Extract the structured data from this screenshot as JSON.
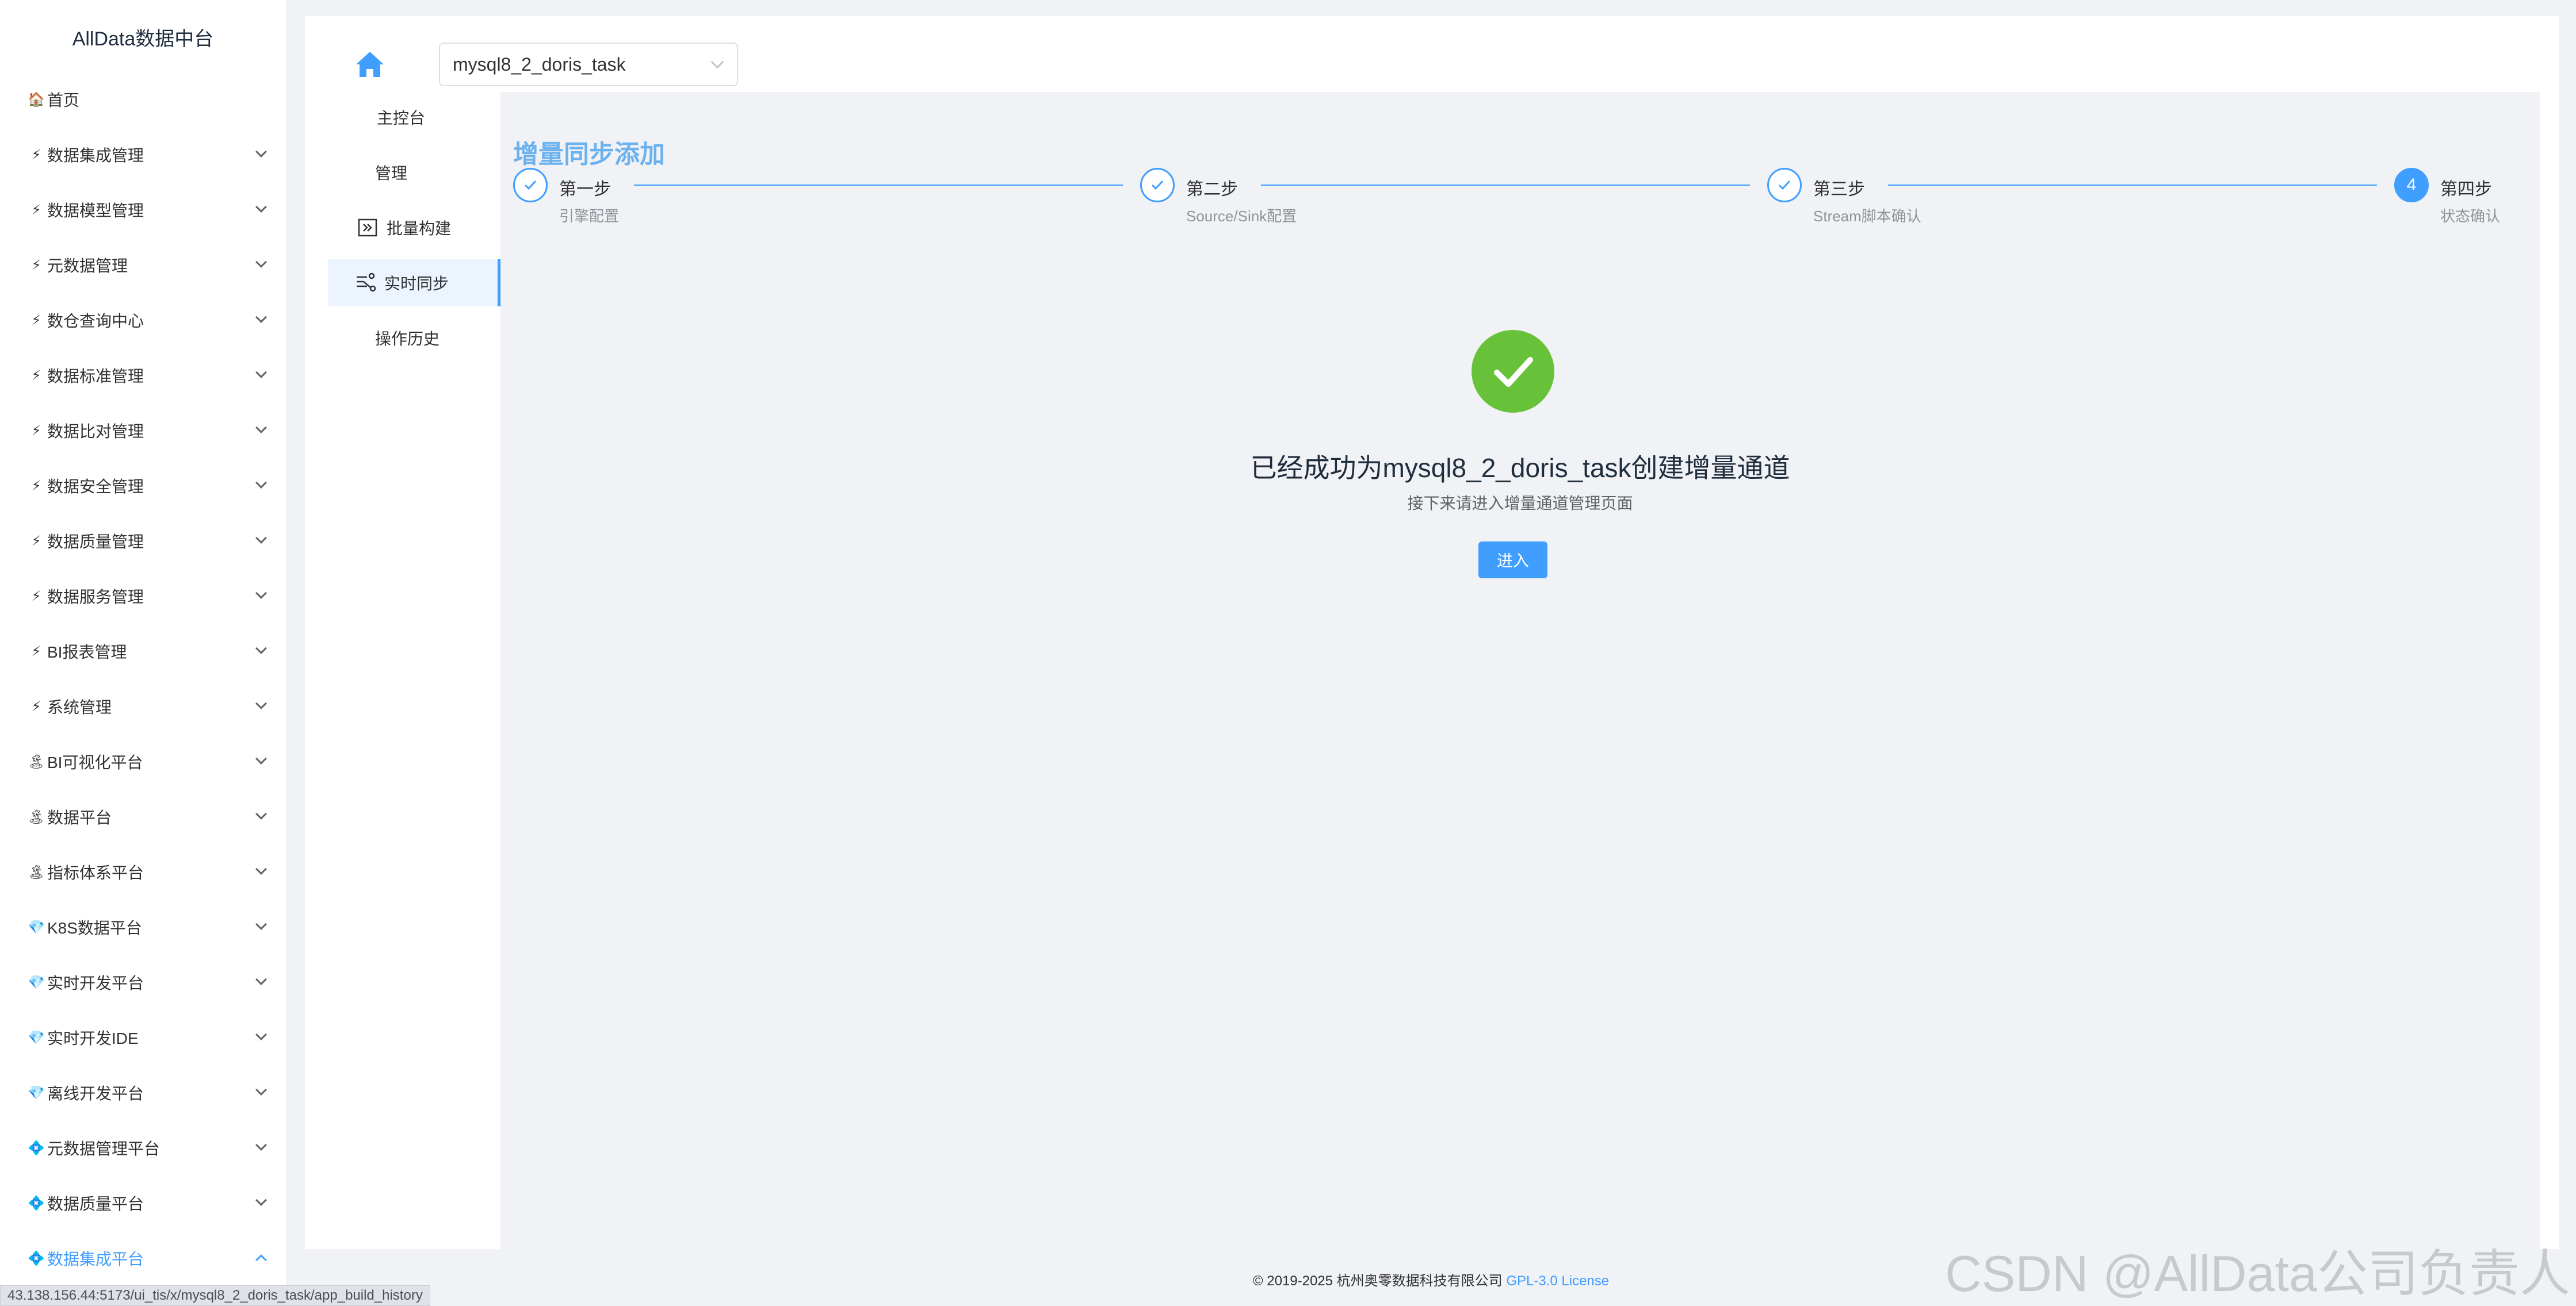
{
  "brand": "AllData数据中台",
  "sidebar": {
    "items": [
      {
        "label": "首页",
        "icon": "🏠",
        "expandable": false
      },
      {
        "label": "数据集成管理",
        "icon": "⚡",
        "expandable": true
      },
      {
        "label": "数据模型管理",
        "icon": "⚡",
        "expandable": true
      },
      {
        "label": "元数据管理",
        "icon": "⚡",
        "expandable": true
      },
      {
        "label": "数仓查询中心",
        "icon": "⚡",
        "expandable": true
      },
      {
        "label": "数据标准管理",
        "icon": "⚡",
        "expandable": true
      },
      {
        "label": "数据比对管理",
        "icon": "⚡",
        "expandable": true
      },
      {
        "label": "数据安全管理",
        "icon": "⚡",
        "expandable": true
      },
      {
        "label": "数据质量管理",
        "icon": "⚡",
        "expandable": true
      },
      {
        "label": "数据服务管理",
        "icon": "⚡",
        "expandable": true
      },
      {
        "label": "BI报表管理",
        "icon": "⚡",
        "expandable": true
      },
      {
        "label": "系统管理",
        "icon": "⚡",
        "expandable": true
      },
      {
        "label": "BI可视化平台",
        "icon": "🏝",
        "expandable": true
      },
      {
        "label": "数据平台",
        "icon": "🏝",
        "expandable": true
      },
      {
        "label": "指标体系平台",
        "icon": "🏝",
        "expandable": true
      },
      {
        "label": "K8S数据平台",
        "icon": "💎",
        "expandable": true
      },
      {
        "label": "实时开发平台",
        "icon": "💎",
        "expandable": true
      },
      {
        "label": "实时开发IDE",
        "icon": "💎",
        "expandable": true
      },
      {
        "label": "离线开发平台",
        "icon": "💎",
        "expandable": true
      },
      {
        "label": "元数据管理平台",
        "icon": "💠",
        "expandable": true
      },
      {
        "label": "数据质量平台",
        "icon": "💠",
        "expandable": true
      },
      {
        "label": "数据集成平台",
        "icon": "💠",
        "expandable": true,
        "active": true
      }
    ]
  },
  "header": {
    "task_select_value": "mysql8_2_doris_task"
  },
  "subnav": {
    "items": [
      {
        "label": "主控台"
      },
      {
        "label": "管理"
      },
      {
        "label": "批量构建",
        "icon": "batch-build-icon"
      },
      {
        "label": "实时同步",
        "icon": "realtime-sync-icon",
        "active": true
      },
      {
        "label": "操作历史"
      }
    ]
  },
  "page": {
    "title": "增量同步添加",
    "steps": [
      {
        "title": "第一步",
        "desc": "引擎配置",
        "status": "done"
      },
      {
        "title": "第二步",
        "desc": "Source/Sink配置",
        "status": "done"
      },
      {
        "title": "第三步",
        "desc": "Stream脚本确认",
        "status": "done"
      },
      {
        "title": "第四步",
        "desc": "状态确认",
        "status": "current",
        "number": "4"
      }
    ],
    "result_title": "已经成功为mysql8_2_doris_task创建增量通道",
    "result_sub": "接下来请进入增量通道管理页面",
    "enter_button": "进入"
  },
  "footer": {
    "copyright": "© 2019-2025 杭州奥零数据科技有限公司",
    "license_link": "GPL-3.0 License"
  },
  "watermark": "CSDN @AllData公司负责人",
  "status_url": "43.138.156.44:5173/ui_tis/x/mysql8_2_doris_task/app_build_history",
  "colors": {
    "accent": "#409eff",
    "success": "#67c23a",
    "title": "#6cb2ef"
  }
}
